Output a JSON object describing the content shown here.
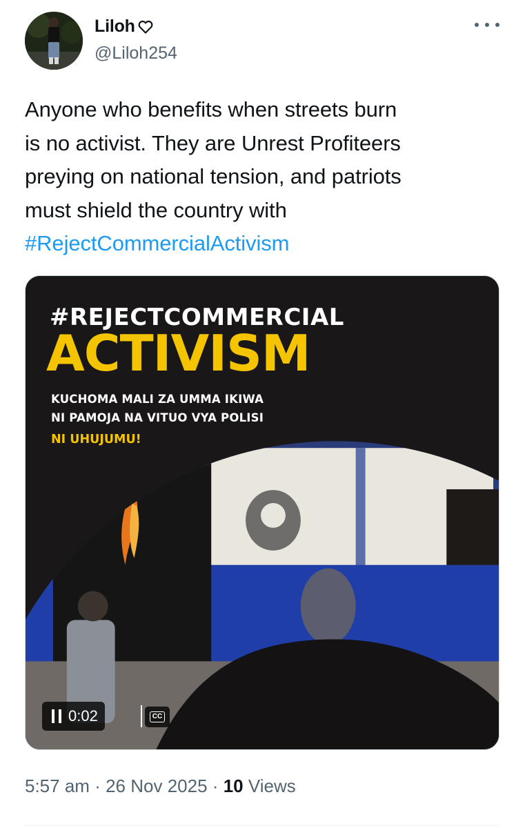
{
  "author": {
    "display_name": "Liloh",
    "handle": "@Liloh254",
    "avatar_icon": "avatar-photo",
    "name_emoji_icon": "heart-outline-icon"
  },
  "menu": {
    "more_icon": "more-horizontal-icon"
  },
  "tweet": {
    "text_lines": [
      "Anyone who benefits when streets burn",
      "is no activist. They are Unrest Profiteers",
      "preying on national tension, and patriots",
      "must shield the country with"
    ],
    "hashtag": "#RejectCommercialActivism"
  },
  "media": {
    "overlay": {
      "hashtag": "#REJECTCOMMERCIAL",
      "headline": "ACTIVISM",
      "line1": "KUCHOMA MALI ZA UMMA IKIWA",
      "line2": "NI PAMOJA NA VITUO VYA POLISI",
      "line3": "NI UHUJUMU!"
    },
    "video": {
      "time": "0:02",
      "cc_label": "CC",
      "state": "playing"
    }
  },
  "meta": {
    "time": "5:57 am",
    "separator": "·",
    "date": "26 Nov 2025",
    "views_count": "10",
    "views_label": "Views"
  },
  "colors": {
    "accent": "#1d9bf0",
    "text": "#0f1419",
    "secondary": "#536471",
    "headline_yellow": "#f5c400"
  }
}
